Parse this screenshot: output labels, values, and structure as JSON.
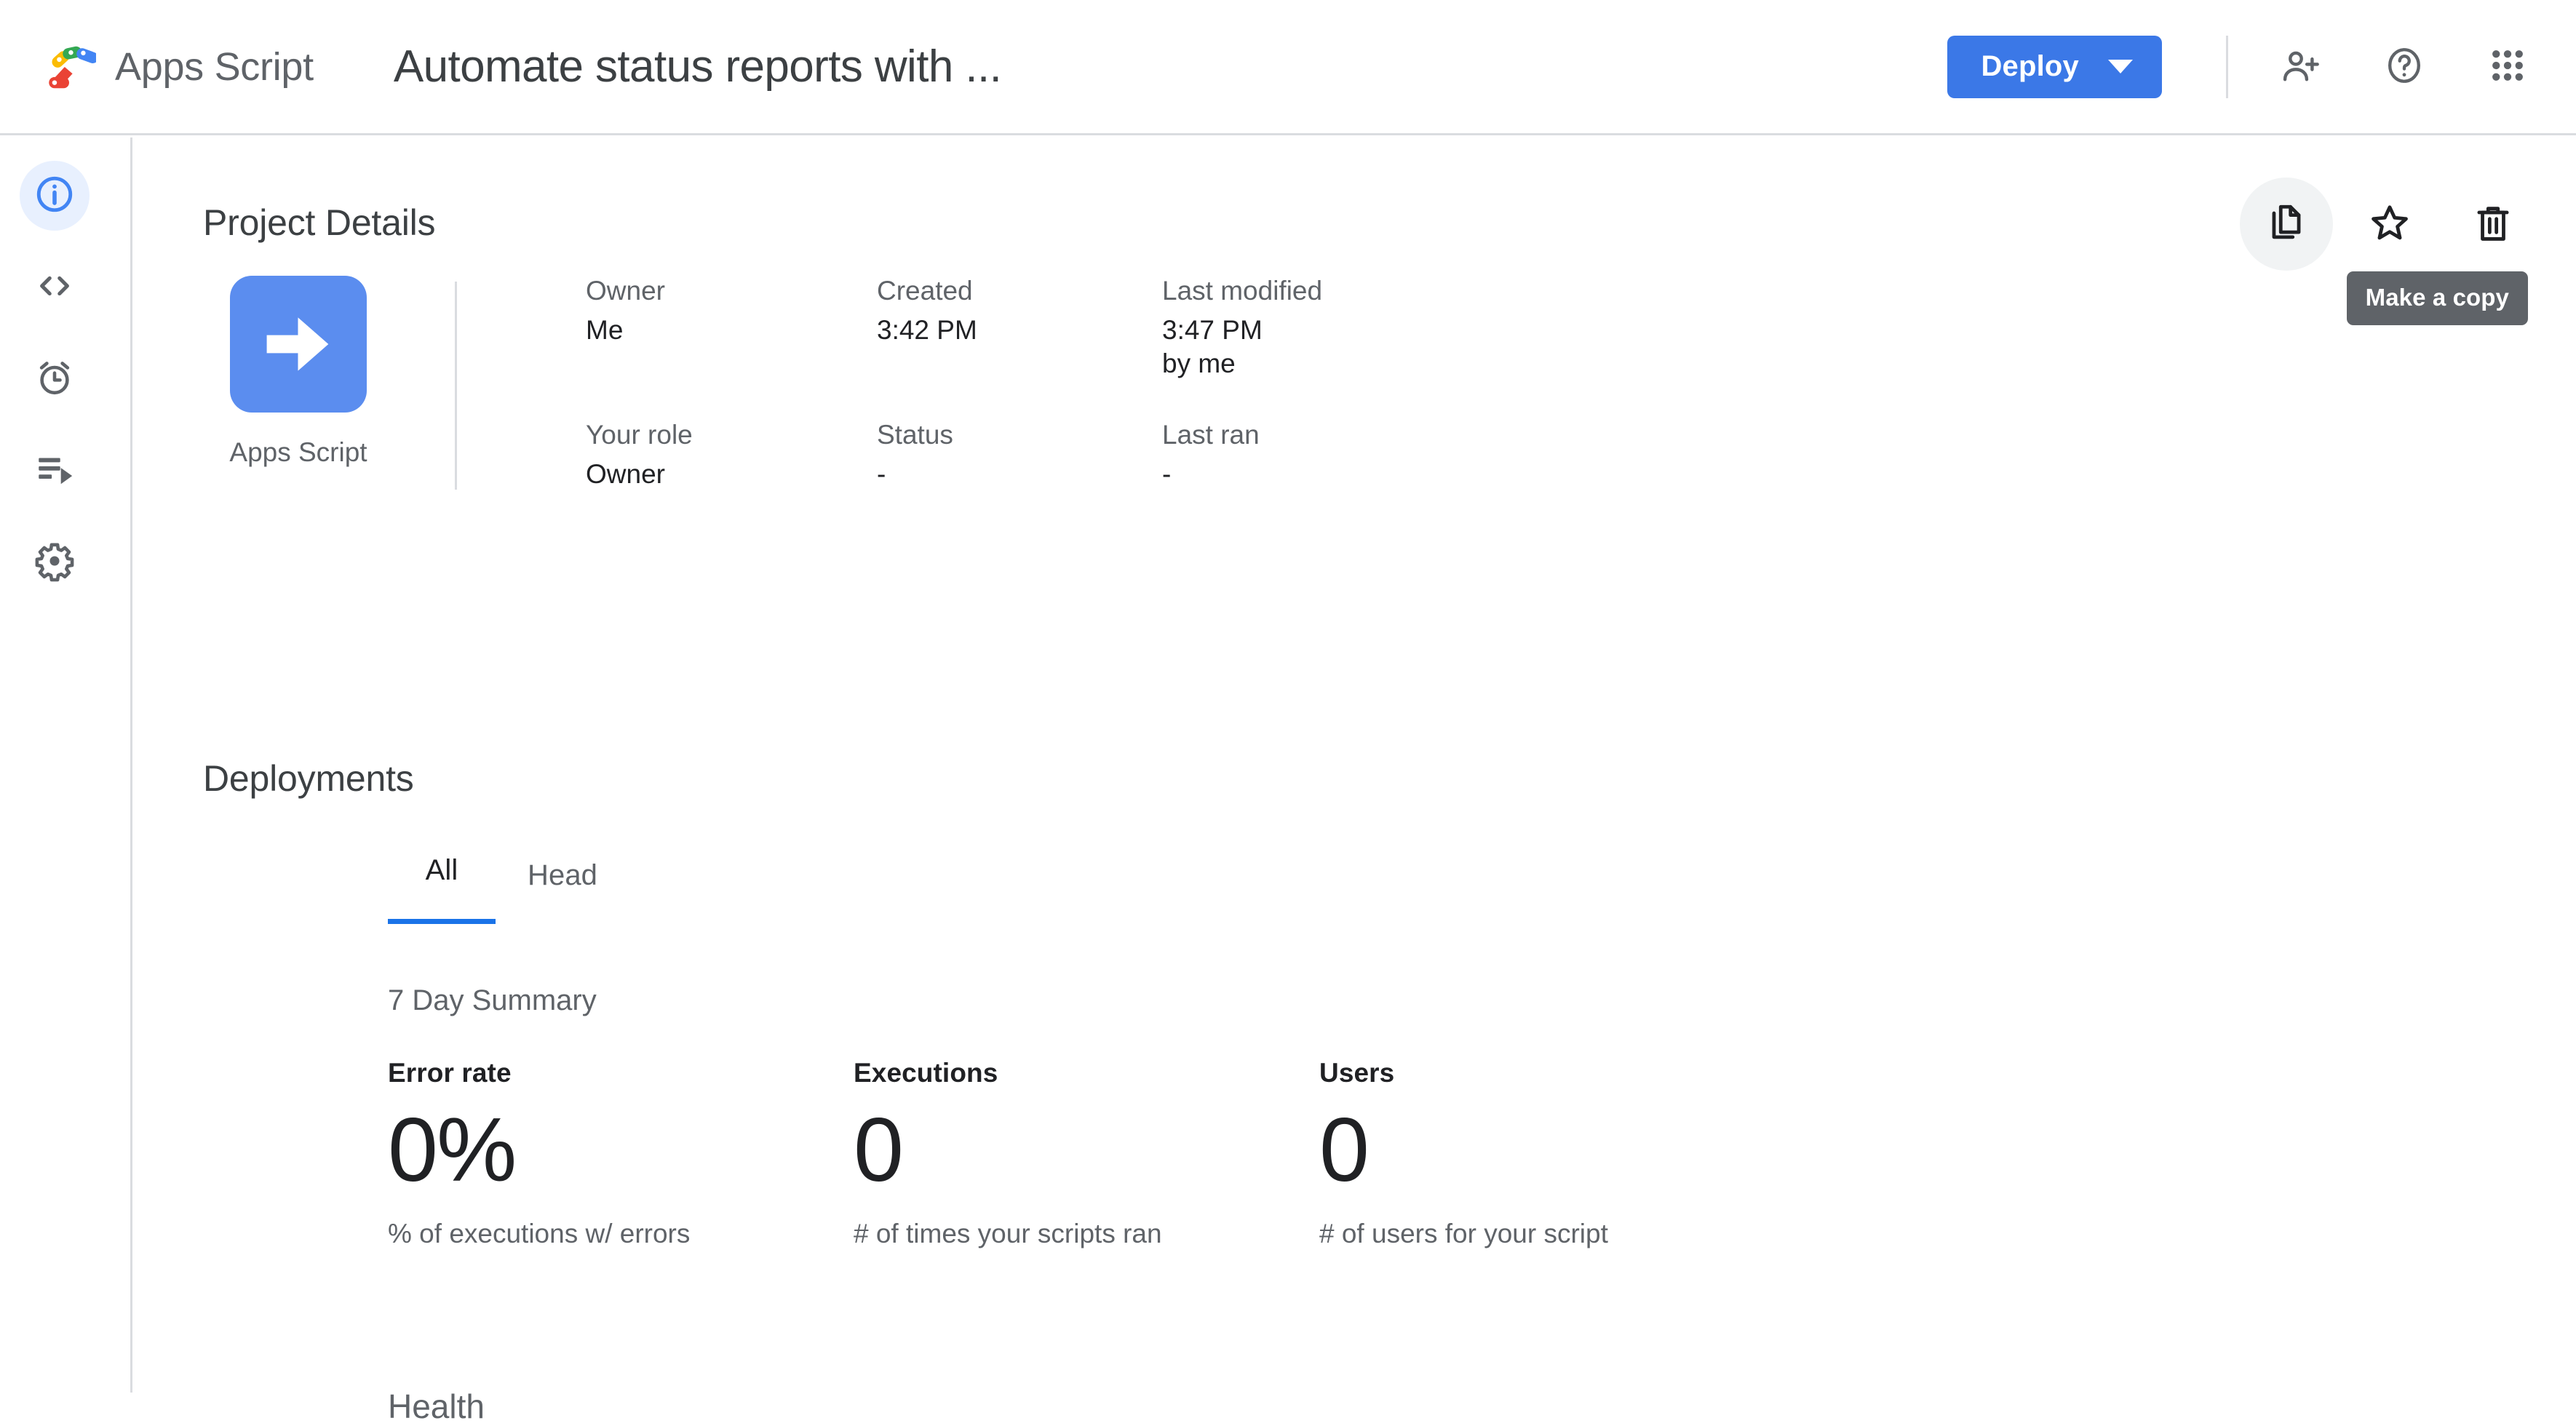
{
  "header": {
    "brand_label": "Apps Script",
    "brand_logo_icon": "apps-script-logo",
    "doc_title": "Automate status reports with ...",
    "deploy_label": "Deploy",
    "deploy_caret_icon": "chevron-down-icon",
    "add_person_icon": "person-add-icon",
    "help_icon": "help-circle-icon",
    "apps_grid_icon": "apps-grid-icon",
    "accent_blue": "#3b78e7"
  },
  "sidebar": {
    "items": [
      {
        "name": "overview",
        "icon": "info-circle-icon",
        "active": true
      },
      {
        "name": "editor",
        "icon": "code-brackets-icon",
        "active": false
      },
      {
        "name": "triggers",
        "icon": "alarm-clock-icon",
        "active": false
      },
      {
        "name": "executions",
        "icon": "executions-list-play-icon",
        "active": false
      },
      {
        "name": "project-settings",
        "icon": "gear-icon",
        "active": false
      }
    ],
    "active_bg": "#e8f0fe",
    "active_fg": "#4285f4",
    "inactive_fg": "#5f6368"
  },
  "project_details": {
    "title": "Project Details",
    "actions": [
      {
        "name": "make-a-copy",
        "icon": "copy-icon",
        "hovered": true
      },
      {
        "name": "star",
        "icon": "star-outline-icon",
        "hovered": false
      },
      {
        "name": "delete",
        "icon": "trash-icon",
        "hovered": false
      }
    ],
    "tooltip": "Make a copy",
    "type_label": "Apps Script",
    "type_icon": "arrow-right-square-icon",
    "type_icon_color": "#5b8def",
    "fields": [
      {
        "label": "Owner",
        "value": "Me"
      },
      {
        "label": "Created",
        "value": "3:42 PM"
      },
      {
        "label": "Last modified",
        "value": "3:47 PM\nby me"
      },
      {
        "label": "Your role",
        "value": "Owner"
      },
      {
        "label": "Status",
        "value": "-"
      },
      {
        "label": "Last ran",
        "value": "-"
      }
    ]
  },
  "deployments": {
    "title": "Deployments",
    "tabs": [
      {
        "label": "All",
        "active": true
      },
      {
        "label": "Head",
        "active": false
      }
    ],
    "summary_title": "7 Day Summary",
    "stats": [
      {
        "label": "Error rate",
        "value": "0%",
        "desc": "% of executions w/ errors"
      },
      {
        "label": "Executions",
        "value": "0",
        "desc": "# of times your scripts ran"
      },
      {
        "label": "Users",
        "value": "0",
        "desc": "# of users for your script"
      }
    ],
    "health_title": "Health"
  }
}
